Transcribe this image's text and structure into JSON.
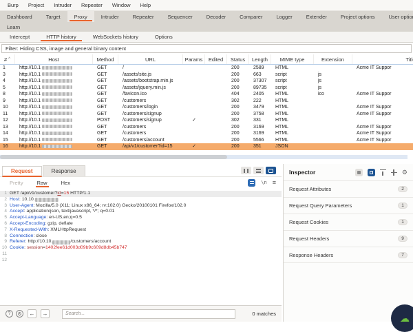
{
  "colors": {
    "accent": "#e8632c",
    "row_selected": "#f5ab6b",
    "key_blue": "#1f54c9",
    "value_red": "#d22f2f",
    "param_maroon": "#a03232",
    "icon_blue": "#2e6cb5",
    "dark_blue": "#1d5492",
    "fab_bg": "#1e2a44",
    "fab_green": "#6cbf3f"
  },
  "icons": {
    "sort_asc": "^",
    "check": "✓",
    "help": "?",
    "settings": "⚙",
    "prev": "←",
    "next": "→",
    "editor_menu": "≡",
    "fab": "☁"
  },
  "menubar": {
    "items": [
      "Burp",
      "Project",
      "Intruder",
      "Repeater",
      "Window",
      "Help"
    ]
  },
  "main_tabs": {
    "row1": [
      "Dashboard",
      "Target",
      "Proxy",
      "Intruder",
      "Repeater",
      "Sequencer",
      "Decoder",
      "Comparer",
      "Logger",
      "Extender",
      "Project options",
      "User options"
    ],
    "row2": [
      "Learn"
    ],
    "selected": "Proxy"
  },
  "sub_tabs": {
    "items": [
      "Intercept",
      "HTTP history",
      "WebSockets history",
      "Options"
    ],
    "selected": "HTTP history"
  },
  "filter_bar": {
    "text": "Filter: Hiding CSS, image and general binary content"
  },
  "table": {
    "columns": [
      "#",
      "Host",
      "Method",
      "URL",
      "Params",
      "Edited",
      "Status",
      "Length",
      "MIME type",
      "Extension",
      "Title"
    ],
    "host_prefix": "http://10.1",
    "rows": [
      {
        "num": "1",
        "method": "GET",
        "url": "/",
        "params": "",
        "status": "200",
        "length": "2589",
        "mime": "HTML",
        "extension": "",
        "title": "Acme IT Suppor",
        "selected": false
      },
      {
        "num": "3",
        "method": "GET",
        "url": "/assets/site.js",
        "params": "",
        "status": "200",
        "length": "663",
        "mime": "script",
        "extension": "js",
        "title": "",
        "selected": false
      },
      {
        "num": "4",
        "method": "GET",
        "url": "/assets/bootstrap.min.js",
        "params": "",
        "status": "200",
        "length": "37307",
        "mime": "script",
        "extension": "js",
        "title": "",
        "selected": false
      },
      {
        "num": "5",
        "method": "GET",
        "url": "/assets/jquery.min.js",
        "params": "",
        "status": "200",
        "length": "89735",
        "mime": "script",
        "extension": "js",
        "title": "",
        "selected": false
      },
      {
        "num": "8",
        "method": "GET",
        "url": "/favicon.ico",
        "params": "",
        "status": "404",
        "length": "2405",
        "mime": "HTML",
        "extension": "ico",
        "title": "Acme IT Suppor",
        "selected": false
      },
      {
        "num": "9",
        "method": "GET",
        "url": "/customers",
        "params": "",
        "status": "302",
        "length": "222",
        "mime": "HTML",
        "extension": "",
        "title": "",
        "selected": false
      },
      {
        "num": "10",
        "method": "GET",
        "url": "/customers/login",
        "params": "",
        "status": "200",
        "length": "3479",
        "mime": "HTML",
        "extension": "",
        "title": "Acme IT Suppor",
        "selected": false
      },
      {
        "num": "11",
        "method": "GET",
        "url": "/customers/signup",
        "params": "",
        "status": "200",
        "length": "3758",
        "mime": "HTML",
        "extension": "",
        "title": "Acme IT Suppor",
        "selected": false
      },
      {
        "num": "12",
        "method": "POST",
        "url": "/customers/signup",
        "params": "✓",
        "status": "302",
        "length": "331",
        "mime": "HTML",
        "extension": "",
        "title": "",
        "selected": false
      },
      {
        "num": "13",
        "method": "GET",
        "url": "/customers",
        "params": "",
        "status": "200",
        "length": "3169",
        "mime": "HTML",
        "extension": "",
        "title": "Acme IT Suppor",
        "selected": false
      },
      {
        "num": "14",
        "method": "GET",
        "url": "/customers",
        "params": "",
        "status": "200",
        "length": "3169",
        "mime": "HTML",
        "extension": "",
        "title": "Acme IT Suppor",
        "selected": false
      },
      {
        "num": "15",
        "method": "GET",
        "url": "/customers/account",
        "params": "",
        "status": "200",
        "length": "5566",
        "mime": "HTML",
        "extension": "",
        "title": "Acme IT Suppor",
        "selected": false
      },
      {
        "num": "16",
        "method": "GET",
        "url": "/api/v1/customer?id=15",
        "params": "✓",
        "status": "200",
        "length": "351",
        "mime": "JSON",
        "extension": "",
        "title": "",
        "selected": true
      }
    ]
  },
  "editor": {
    "message_tabs": [
      "Request",
      "Response"
    ],
    "selected_message_tab": "Request",
    "view_tabs": [
      "Pretty",
      "Raw",
      "Hex"
    ],
    "selected_view_tab": "Raw",
    "disabled_view_tabs": [
      "Pretty"
    ],
    "newline_label": "\\n",
    "active_line": "1",
    "lines": [
      {
        "num": "1",
        "segs": [
          [
            "GET /api/v1/customer?",
            "p"
          ],
          [
            "id",
            "u"
          ],
          [
            "=",
            "p"
          ],
          [
            "15",
            "r"
          ],
          [
            " HTTP/1.1",
            "p"
          ]
        ]
      },
      {
        "num": "2",
        "segs": [
          [
            "Host",
            "k"
          ],
          [
            ": 10.10.",
            "p"
          ],
          [
            "",
            "b",
            34
          ]
        ]
      },
      {
        "num": "3",
        "segs": [
          [
            "User-Agent",
            "k"
          ],
          [
            ": Mozilla/5.0 (X11; Linux x86_64; rv:102.0) Gecko/20100101 Firefox/102.0",
            "p"
          ]
        ]
      },
      {
        "num": "4",
        "segs": [
          [
            "Accept",
            "k"
          ],
          [
            ": application/json, text/javascript, */*; q=0.01",
            "p"
          ]
        ]
      },
      {
        "num": "5",
        "segs": [
          [
            "Accept-Language",
            "k"
          ],
          [
            ": en-US,en;q=0.5",
            "p"
          ]
        ]
      },
      {
        "num": "6",
        "segs": [
          [
            "Accept-Encoding",
            "k"
          ],
          [
            ": gzip, deflate",
            "p"
          ]
        ]
      },
      {
        "num": "7",
        "segs": [
          [
            "X-Requested-With",
            "k"
          ],
          [
            ": XMLHttpRequest",
            "p"
          ]
        ]
      },
      {
        "num": "8",
        "segs": [
          [
            "Connection",
            "k"
          ],
          [
            ": close",
            "p"
          ]
        ]
      },
      {
        "num": "9",
        "segs": [
          [
            "Referer",
            "k"
          ],
          [
            ": http://10.10.",
            "p"
          ],
          [
            "",
            "b",
            26
          ],
          [
            "/customers/account",
            "p"
          ]
        ]
      },
      {
        "num": "10",
        "segs": [
          [
            "Cookie",
            "k"
          ],
          [
            ": ",
            "p"
          ],
          [
            "session",
            "m"
          ],
          [
            "=",
            "p"
          ],
          [
            "1402fee61d003d09b9c609d8db45b747",
            "r"
          ]
        ]
      },
      {
        "num": "11",
        "segs": []
      },
      {
        "num": "12",
        "segs": []
      }
    ]
  },
  "search_bar": {
    "placeholder": "Search...",
    "matches": "0 matches"
  },
  "inspector": {
    "title": "Inspector",
    "sections": [
      {
        "label": "Request Attributes",
        "count": "2"
      },
      {
        "label": "Request Query Parameters",
        "count": "1"
      },
      {
        "label": "Request Cookies",
        "count": "1"
      },
      {
        "label": "Request Headers",
        "count": "9"
      },
      {
        "label": "Response Headers",
        "count": "7"
      }
    ]
  }
}
